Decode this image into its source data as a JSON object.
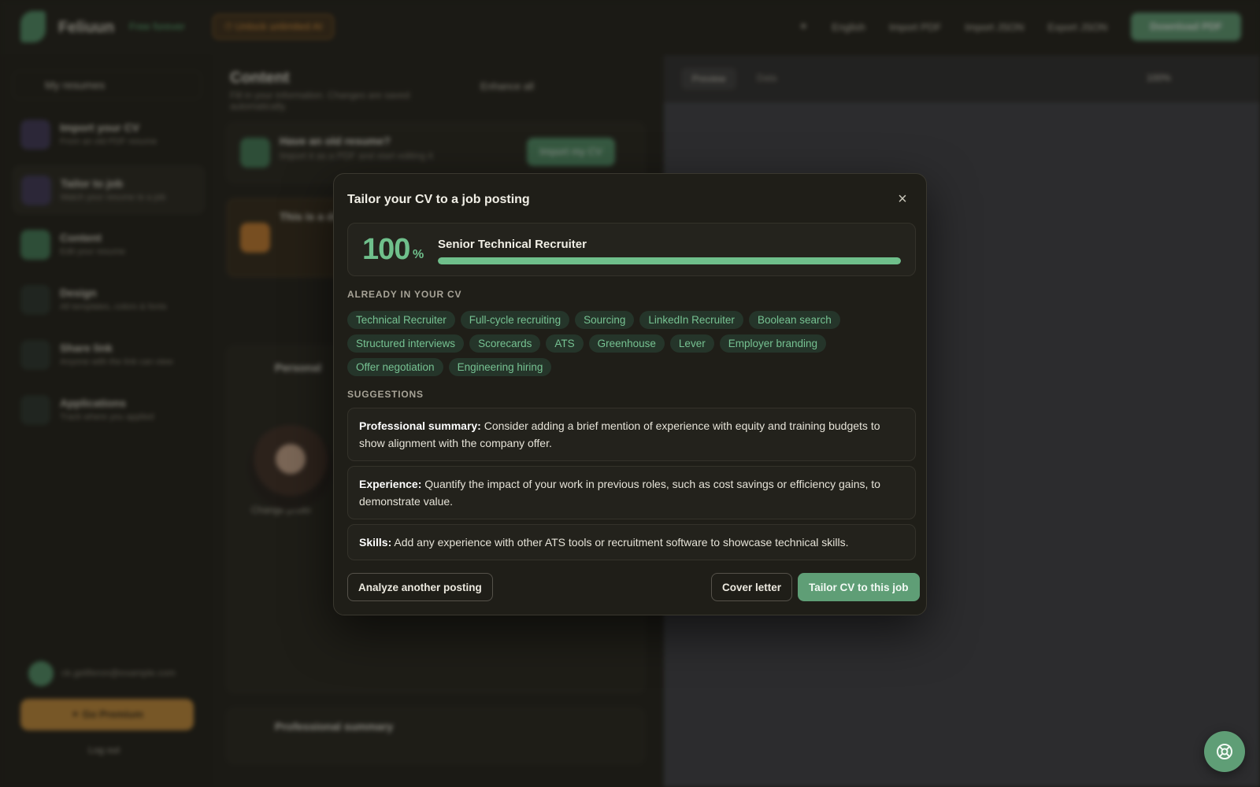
{
  "background": {
    "topbar": {
      "app_name": "Feliuun",
      "badge": "Free forever",
      "promo": "⏱ Unlock unlimited AI",
      "language": "English",
      "import_pdf": "Import PDF",
      "import_json": "Import JSON",
      "export_json": "Export JSON",
      "download_pdf": "Download PDF"
    },
    "sidebar": {
      "header": "My resumes",
      "items": [
        {
          "title": "Import your CV",
          "subtitle": "From an old PDF resume"
        },
        {
          "title": "Tailor to job",
          "subtitle": "Match your resume to a job"
        },
        {
          "title": "Content",
          "subtitle": "Edit your resume"
        },
        {
          "title": "Design",
          "subtitle": "All templates, colors & fonts"
        },
        {
          "title": "Share link",
          "subtitle": "Anyone with the link can view"
        },
        {
          "title": "Applications",
          "subtitle": "Track where you applied"
        }
      ],
      "user_email": "ck.geliferon@example.com",
      "premium": "✦ Go Premium",
      "logout": "Log out"
    },
    "editor": {
      "title": "Content",
      "subtitle": "Fill in your information. Changes are saved automatically.",
      "enhance_all": "Enhance all",
      "import_card_title": "Have an old resume?",
      "import_card_sub": "Import it as a PDF and start editing it",
      "import_card_btn": "Import my CV",
      "warn_card_title": "This is a demo",
      "section_personal": "Personal",
      "change_photo": "Change photo",
      "section_summary": "Professional summary"
    },
    "preview": {
      "tab_preview": "Preview",
      "tab_data": "Data",
      "zoom": "100%"
    }
  },
  "modal": {
    "title": "Tailor your CV to a job posting",
    "close_label": "×",
    "score": {
      "value": "100",
      "unit": "%",
      "fill_percent": 100,
      "job_title": "Senior Technical Recruiter"
    },
    "already_label": "ALREADY IN YOUR CV",
    "skills": [
      "Technical Recruiter",
      "Full-cycle recruiting",
      "Sourcing",
      "LinkedIn Recruiter",
      "Boolean search",
      "Structured interviews",
      "Scorecards",
      "ATS",
      "Greenhouse",
      "Lever",
      "Employer branding",
      "Offer negotiation",
      "Engineering hiring"
    ],
    "suggestions_label": "SUGGESTIONS",
    "suggestions": [
      {
        "heading": "Professional summary:",
        "text": " Consider adding a brief mention of experience with equity and training budgets to show alignment with the company offer."
      },
      {
        "heading": "Experience:",
        "text": " Quantify the impact of your work in previous roles, such as cost savings or efficiency gains, to demonstrate value."
      },
      {
        "heading": "Skills:",
        "text": " Add any experience with other ATS tools or recruitment software to showcase technical skills."
      }
    ],
    "buttons": {
      "analyze": "Analyze another posting",
      "cover_letter": "Cover letter",
      "tailor": "Tailor CV to this job"
    }
  },
  "colors": {
    "accent": "#6fbf8b",
    "primary_button": "#5f9e76",
    "tag_bg": "#25352a",
    "modal_bg": "#1f1e18"
  }
}
